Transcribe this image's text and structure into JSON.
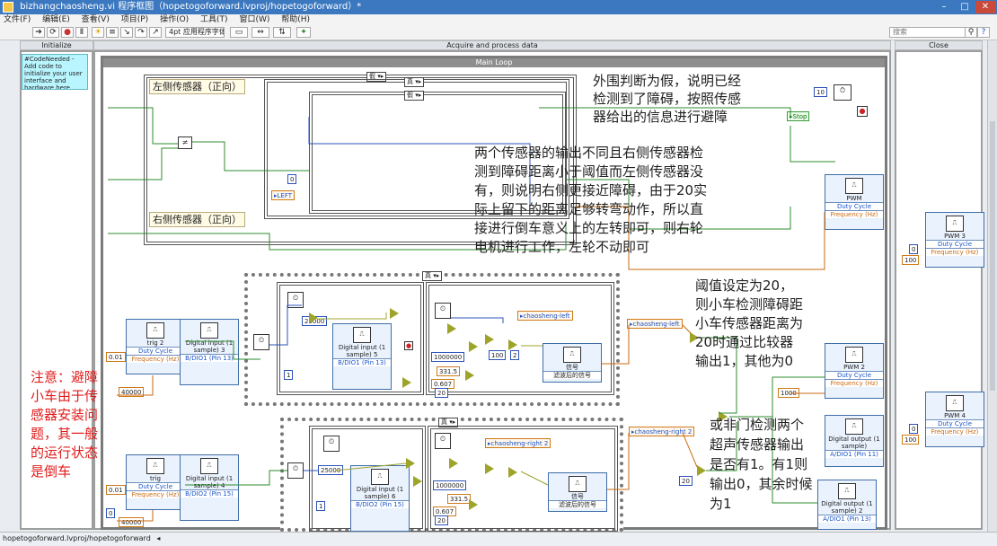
{
  "window": {
    "title": "bizhangchaosheng.vi 程序框图（hopetogoforward.lvproj/hopetogoforward）*",
    "controls": [
      "–",
      "□",
      "✕"
    ]
  },
  "menu": [
    "文件(F)",
    "编辑(E)",
    "查看(V)",
    "项目(P)",
    "操作(O)",
    "工具(T)",
    "窗口(W)",
    "帮助(H)"
  ],
  "toolbar": {
    "font_select": "4pt 应用程序字体",
    "search_placeholder": "搜索"
  },
  "frames": {
    "initialize": "Initialize",
    "acquire": "Acquire and process data",
    "close": "Close"
  },
  "code_needed": "#CodeNeeded - Add code to initialize your user interface and hardware here.",
  "main_loop": "Main Loop",
  "case_selectors": {
    "false1": "假",
    "true1": "真",
    "false2": "假",
    "true_seq1": "真",
    "true_seq2": "真"
  },
  "labels": {
    "left_sensor": "左侧传感器（正向）",
    "right_sensor": "右侧传感器（正向）",
    "left_local": "LEFT",
    "stop_local": "Stop",
    "chaosheng_left": "chaosheng-left",
    "chaosheng_left_2": "chaosheng-left",
    "chaosheng_right": "chaosheng-right 2",
    "chaosheng_right_2": "chaosheng-right 2"
  },
  "express_vis": {
    "pwm": {
      "title": "PWM",
      "r1": "Duty Cycle",
      "r2": "Frequency (Hz)"
    },
    "pwm2": {
      "title": "PWM 2",
      "r1": "Duty Cycle",
      "r2": "Frequency (Hz)"
    },
    "pwm3": {
      "title": "PWM 3",
      "r1": "Duty Cycle",
      "r2": "Frequency (Hz)"
    },
    "pwm4": {
      "title": "PWM 4",
      "r1": "Duty Cycle",
      "r2": "Frequency (Hz)"
    },
    "trig2": {
      "title": "trig 2",
      "r1": "Duty Cycle",
      "r2": "Frequency (Hz)"
    },
    "trig": {
      "title": "trig",
      "r1": "Duty Cycle",
      "r2": "Frequency (Hz)"
    },
    "din3": {
      "title": "Digital input (1 sample) 3",
      "r1": "B/DIO1 (Pin 13)"
    },
    "din4": {
      "title": "Digital input (1 sample) 4",
      "r1": "B/DIO2 (Pin 15)"
    },
    "din5": {
      "title": "Digital input (1 sample) 5",
      "r1": "B/DIO1 (Pin 13)"
    },
    "din6": {
      "title": "Digital input (1 sample) 6",
      "r1": "B/DIO2 (Pin 15)"
    },
    "dout": {
      "title": "Digital output (1 sample)",
      "r1": "A/DIO1 (Pin 11)"
    },
    "dout2": {
      "title": "Digital output (1 sample) 2",
      "r1": "A/DIO1 (Pin 13)"
    },
    "filter1": {
      "title": "信号",
      "r1": "滤波后的信号"
    },
    "filter2": {
      "title": "信号",
      "r1": "滤波后的信号"
    }
  },
  "constants": {
    "c10": "10",
    "c0_left": "0",
    "c001_a": "0.01",
    "c40000_a": "40000",
    "c001_b": "0.01",
    "c40000_b": "40000",
    "c25000_a": "25000",
    "c25000_b": "25000",
    "c1000000_a": "1000000",
    "c1000000_b": "1000000",
    "c3315_a": "331.5",
    "c3315_b": "331.5",
    "c0607_a": "0.607",
    "c0607_b": "0.607",
    "c20_a": "20",
    "c20_b": "20",
    "c100": "100",
    "c2": "2",
    "c1000": "1000",
    "c0_pwm3": "0",
    "c100_pwm3": "100",
    "c0_pwm4": "0",
    "c100_pwm4": "100",
    "c20_right": "20",
    "c1_a": "1",
    "c1_b": "1",
    "c0_seq": "0"
  },
  "annotations": {
    "outer_false": [
      "外围判断为假，说明已经",
      "检测到了障碍，按照传感",
      "器给出的信息进行避障"
    ],
    "two_sensors": [
      "两个传感器的输出不同且右侧传感器检",
      "测到障碍距离小于阈值而左侧传感器没",
      "有，则说明右侧更接近障碍，由于20实",
      "际上留下的距离足够转弯动作，所以直",
      "接进行倒车意义上的左转即可，则右轮",
      "电机进行工作，左轮不动即可"
    ],
    "threshold": [
      "阈值设定为20，",
      "则小车检测障碍距",
      "小车传感器距离为",
      "20时通过比较器",
      "输出1，其他为0"
    ],
    "nor_gate": [
      "或非门检测两个",
      "超声传感器输出",
      "是否有1。有1则",
      "输出0，其余时候",
      "为1"
    ],
    "note_red": [
      "注意：避障",
      "小车由于传",
      "感器安装问",
      "题，其一般",
      "的运行状态",
      "是倒车"
    ]
  },
  "status_path": "hopetogoforward.lvproj/hopetogoforward"
}
